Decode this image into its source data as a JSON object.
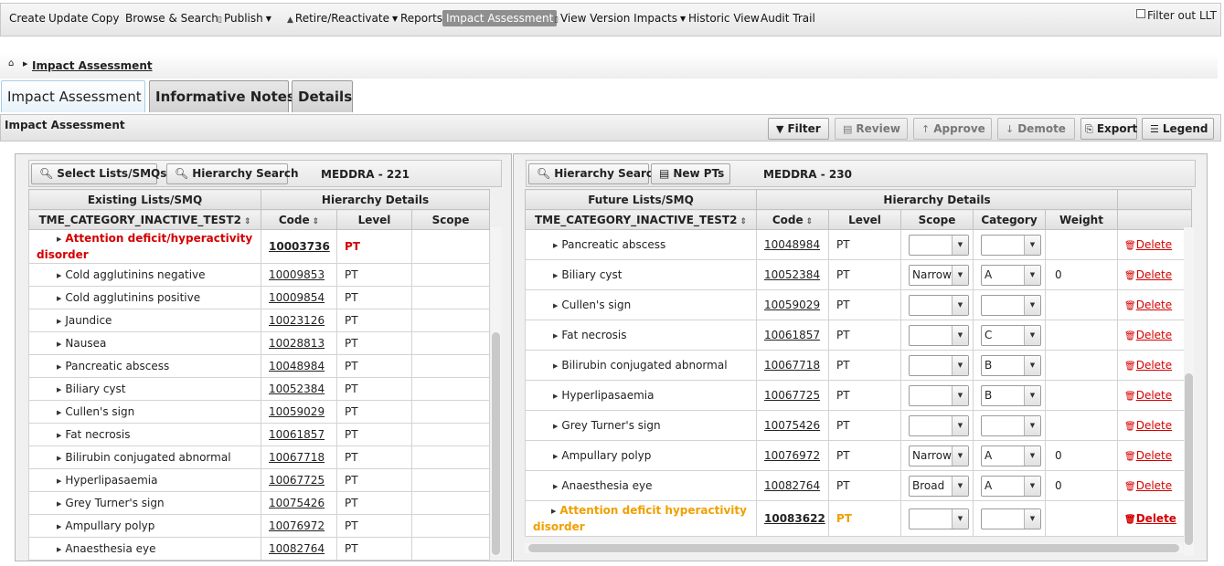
{
  "menu": {
    "create": "Create",
    "update": "Update",
    "copy": "Copy",
    "browse_search": "Browse & Search",
    "publish": "Publish",
    "retire_reactivate": "Retire/Reactivate",
    "reports": "Reports",
    "impact_assessment": "Impact Assessment",
    "view_version_impacts": "View Version Impacts",
    "historic_view": "Historic View",
    "audit_trail": "Audit Trail",
    "filter_out_llt": "Filter out LLT"
  },
  "breadcrumb": {
    "current": "Impact Assessment"
  },
  "tabs": [
    {
      "label": "Impact Assessment",
      "active": true
    },
    {
      "label": "Informative Notes",
      "active": false
    },
    {
      "label": "Details",
      "active": false
    }
  ],
  "section": {
    "title": "Impact Assessment",
    "buttons": {
      "filter": "Filter",
      "review": "Review",
      "approve": "Approve",
      "demote": "Demote",
      "export": "Export",
      "legend": "Legend"
    }
  },
  "left": {
    "select_lists": "Select Lists/SMQs",
    "hierarchy_search": "Hierarchy Search",
    "meddra": "MEDDRA - 221",
    "header_group1": "Existing Lists/SMQ",
    "header_group2": "Hierarchy Details",
    "col_name": "TME_CATEGORY_INACTIVE_TEST2",
    "col_code": "Code",
    "col_level": "Level",
    "col_scope": "Scope",
    "top_row": {
      "name": "Attention deficit/hyperactivity disorder",
      "code": "10003736",
      "level": "PT",
      "scope": ""
    },
    "rows": [
      {
        "name": "Cold agglutinins negative",
        "code": "10009853",
        "level": "PT"
      },
      {
        "name": "Cold agglutinins positive",
        "code": "10009854",
        "level": "PT"
      },
      {
        "name": "Jaundice",
        "code": "10023126",
        "level": "PT"
      },
      {
        "name": "Nausea",
        "code": "10028813",
        "level": "PT"
      },
      {
        "name": "Pancreatic abscess",
        "code": "10048984",
        "level": "PT"
      },
      {
        "name": "Biliary cyst",
        "code": "10052384",
        "level": "PT"
      },
      {
        "name": "Cullen's sign",
        "code": "10059029",
        "level": "PT"
      },
      {
        "name": "Fat necrosis",
        "code": "10061857",
        "level": "PT"
      },
      {
        "name": "Bilirubin conjugated abnormal",
        "code": "10067718",
        "level": "PT"
      },
      {
        "name": "Hyperlipasaemia",
        "code": "10067725",
        "level": "PT"
      },
      {
        "name": "Grey Turner's sign",
        "code": "10075426",
        "level": "PT"
      },
      {
        "name": "Ampullary polyp",
        "code": "10076972",
        "level": "PT"
      },
      {
        "name": "Anaesthesia eye",
        "code": "10082764",
        "level": "PT"
      }
    ]
  },
  "right": {
    "hierarchy_search": "Hierarchy Search",
    "new_pts": "New PTs",
    "meddra": "MEDDRA - 230",
    "header_group1": "Future Lists/SMQ",
    "header_group2": "Hierarchy Details",
    "col_name": "TME_CATEGORY_INACTIVE_TEST2",
    "col_code": "Code",
    "col_level": "Level",
    "col_scope": "Scope",
    "col_category": "Category",
    "col_weight": "Weight",
    "delete_label": "Delete",
    "rows": [
      {
        "name": "Pancreatic abscess",
        "code": "10048984",
        "level": "PT",
        "scope": "",
        "category": "",
        "weight": ""
      },
      {
        "name": "Biliary cyst",
        "code": "10052384",
        "level": "PT",
        "scope": "Narrow",
        "category": "A",
        "weight": "0"
      },
      {
        "name": "Cullen's sign",
        "code": "10059029",
        "level": "PT",
        "scope": "",
        "category": "",
        "weight": ""
      },
      {
        "name": "Fat necrosis",
        "code": "10061857",
        "level": "PT",
        "scope": "",
        "category": "C",
        "weight": ""
      },
      {
        "name": "Bilirubin conjugated abnormal",
        "code": "10067718",
        "level": "PT",
        "scope": "",
        "category": "B",
        "weight": ""
      },
      {
        "name": "Hyperlipasaemia",
        "code": "10067725",
        "level": "PT",
        "scope": "",
        "category": "B",
        "weight": ""
      },
      {
        "name": "Grey Turner's sign",
        "code": "10075426",
        "level": "PT",
        "scope": "",
        "category": "",
        "weight": ""
      },
      {
        "name": "Ampullary polyp",
        "code": "10076972",
        "level": "PT",
        "scope": "Narrow",
        "category": "A",
        "weight": "0"
      },
      {
        "name": "Anaesthesia eye",
        "code": "10082764",
        "level": "PT",
        "scope": "Broad",
        "category": "A",
        "weight": "0"
      }
    ],
    "bottom_row": {
      "name": "Attention deficit hyperactivity disorder",
      "code": "10083622",
      "level": "PT",
      "scope": "",
      "category": "",
      "weight": ""
    }
  },
  "colors": {
    "parent_red": "#d40000",
    "new_orange": "#f0a000",
    "active_tab": "#e7f2fa"
  }
}
